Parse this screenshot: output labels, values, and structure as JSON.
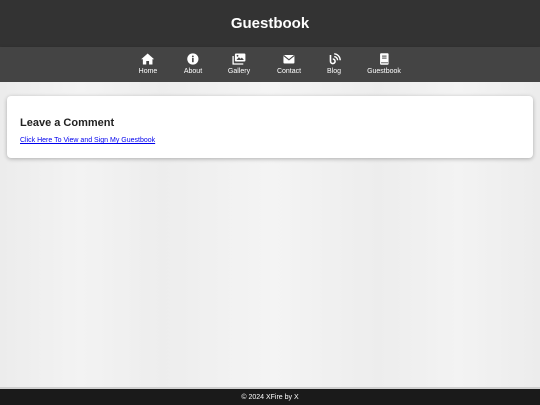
{
  "header": {
    "title": "Guestbook",
    "background": "#333333"
  },
  "nav": {
    "background": "#444444",
    "items": [
      {
        "label": "Home",
        "icon": "home-icon"
      },
      {
        "label": "About",
        "icon": "info-icon"
      },
      {
        "label": "Gallery",
        "icon": "images-icon"
      },
      {
        "label": "Contact",
        "icon": "envelope-icon"
      },
      {
        "label": "Blog",
        "icon": "blog-icon"
      },
      {
        "label": "Guestbook",
        "icon": "book-icon"
      }
    ]
  },
  "card": {
    "title": "Leave a Comment",
    "link_text": "Click Here To View and Sign My Guestbook",
    "link_color": "#0000ee"
  },
  "footer": {
    "text": "© 2024 XFire by X",
    "background": "#1a1a1a"
  }
}
